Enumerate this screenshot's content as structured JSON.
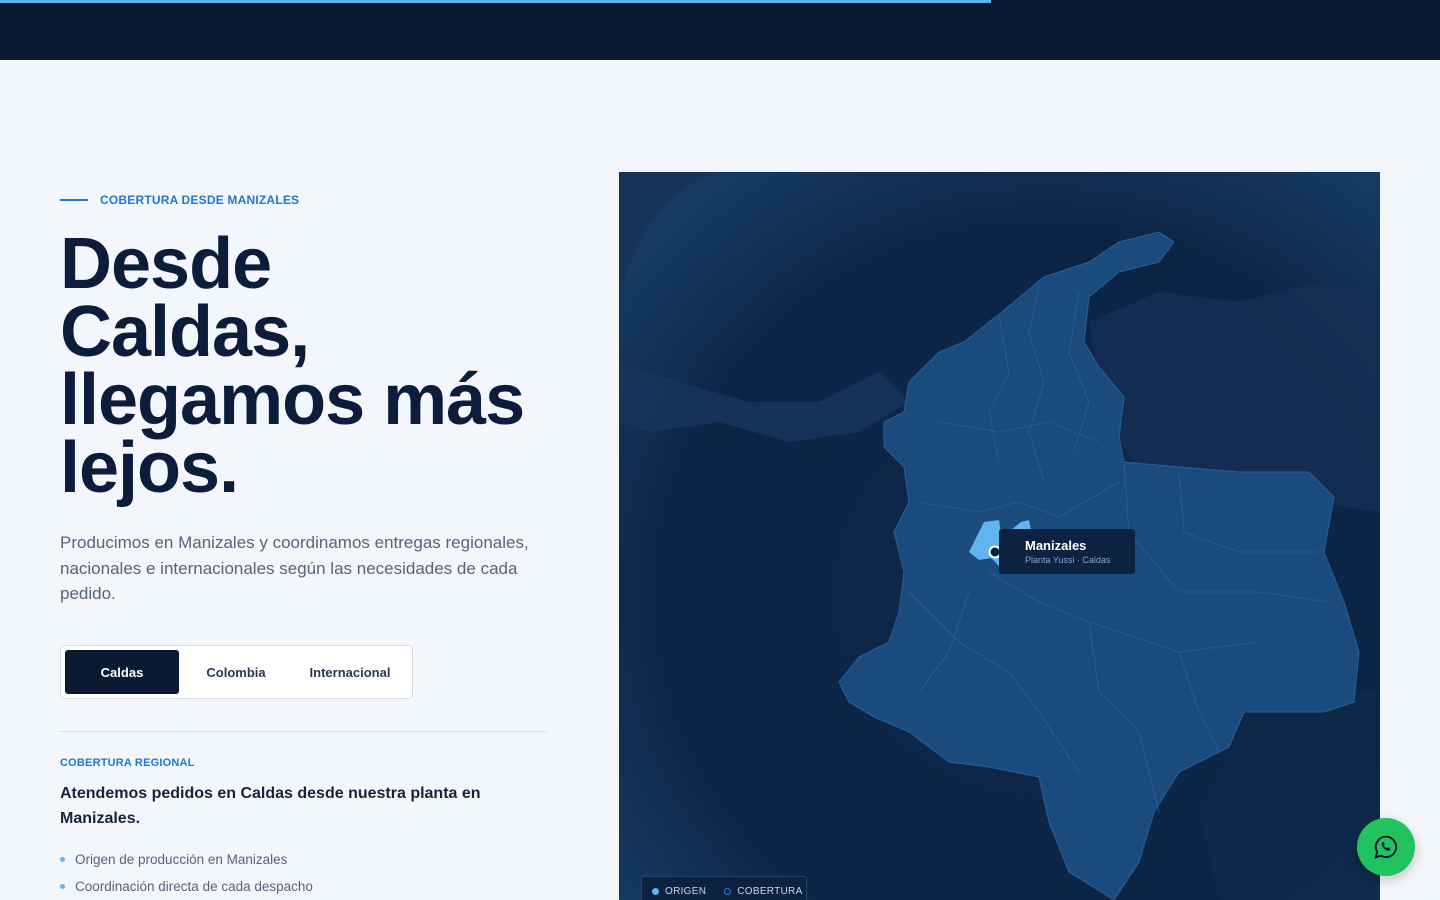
{
  "header": {
    "progress_fraction": 0.688
  },
  "hero": {
    "eyebrow": "COBERTURA DESDE MANIZALES",
    "headline_lines": [
      "Desde",
      "Caldas,",
      "llegamos más",
      "lejos."
    ],
    "intro": "Producimos en Manizales y coordinamos entregas regionales, nacionales e internacionales según las necesidades de cada pedido."
  },
  "tabs": [
    {
      "label": "Caldas",
      "active": true
    },
    {
      "label": "Colombia",
      "active": false
    },
    {
      "label": "Internacional",
      "active": false
    }
  ],
  "coverage": {
    "label": "COBERTURA REGIONAL",
    "text": "Atendemos pedidos en Caldas desde nuestra planta en Manizales.",
    "bullets": [
      "Origen de producción en Manizales",
      "Coordinación directa de cada despacho"
    ]
  },
  "map": {
    "tooltip_title": "Manizales",
    "tooltip_subtitle": "Planta Yussi · Caldas",
    "legend": [
      "ORIGEN",
      "COBERTURA"
    ]
  },
  "colors": {
    "navy": "#0b1a33",
    "accent": "#1f78d1",
    "highlight": "#5fb6ee",
    "whatsapp": "#22c35e"
  },
  "icons": {
    "whatsapp": "whatsapp-icon"
  }
}
